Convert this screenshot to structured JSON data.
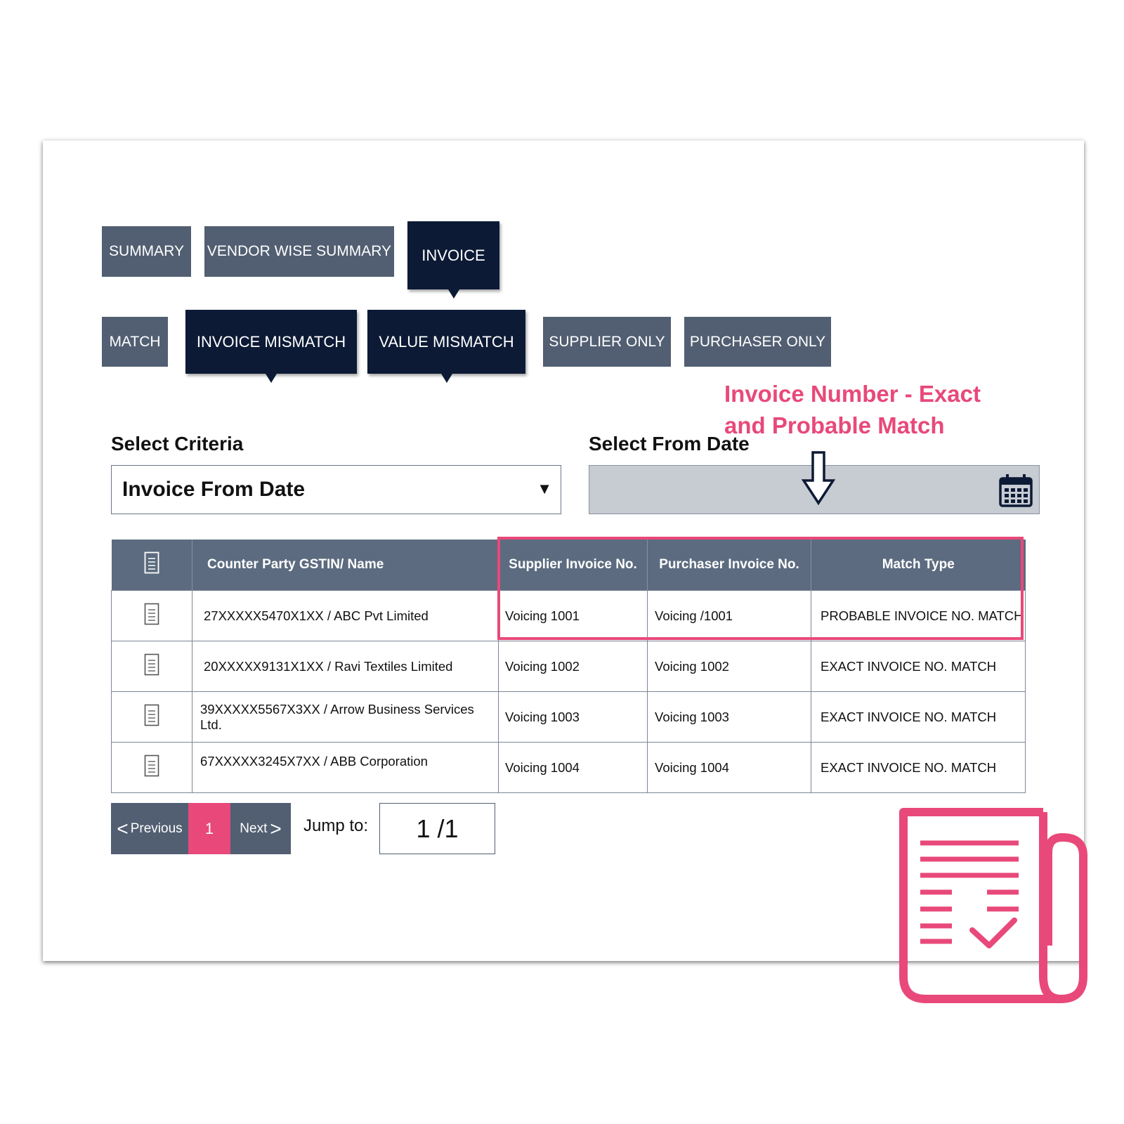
{
  "tabs_row1": [
    {
      "label": "SUMMARY",
      "active": false
    },
    {
      "label": "VENDOR WISE SUMMARY",
      "active": false
    },
    {
      "label": "INVOICE",
      "active": true
    }
  ],
  "tabs_row2": [
    {
      "label": "MATCH",
      "active": false
    },
    {
      "label": "INVOICE MISMATCH",
      "active": true
    },
    {
      "label": "VALUE MISMATCH",
      "active": true
    },
    {
      "label": "SUPPLIER ONLY",
      "active": false
    },
    {
      "label": "PURCHASER ONLY",
      "active": false
    }
  ],
  "callout": {
    "line1": "Invoice Number - Exact",
    "line2": "and Probable Match"
  },
  "criteria": {
    "label": "Select Criteria",
    "value": "Invoice From Date"
  },
  "from_date": {
    "label": "Select From Date",
    "value": ""
  },
  "table": {
    "headers": [
      "",
      "Counter Party GSTIN/ Name",
      "Supplier Invoice No.",
      "Purchaser Invoice No.",
      "Match Type"
    ],
    "rows": [
      [
        "27XXXXX5470X1XX / ABC Pvt Limited",
        "Voicing 1001",
        "Voicing /1001",
        "PROBABLE INVOICE NO. MATCH"
      ],
      [
        "20XXXXX9131X1XX / Ravi Textiles Limited",
        "Voicing 1002",
        "Voicing 1002",
        "EXACT INVOICE NO. MATCH"
      ],
      [
        "39XXXXX5567X3XX / Arrow Business Services Ltd.",
        "Voicing 1003",
        "Voicing 1003",
        "EXACT INVOICE NO. MATCH"
      ],
      [
        "67XXXXX3245X7XX / ABB Corporation",
        "Voicing 1004",
        "Voicing 1004",
        "EXACT INVOICE NO. MATCH"
      ]
    ]
  },
  "pagination": {
    "previous": "Previous",
    "current": "1",
    "next": "Next",
    "jump_label": "Jump to:",
    "jump_value": "1 /1"
  },
  "colors": {
    "accent": "#e8497a",
    "tab_inactive": "#525f72",
    "tab_active": "#0c1a35",
    "table_header": "#5c6b7f"
  }
}
